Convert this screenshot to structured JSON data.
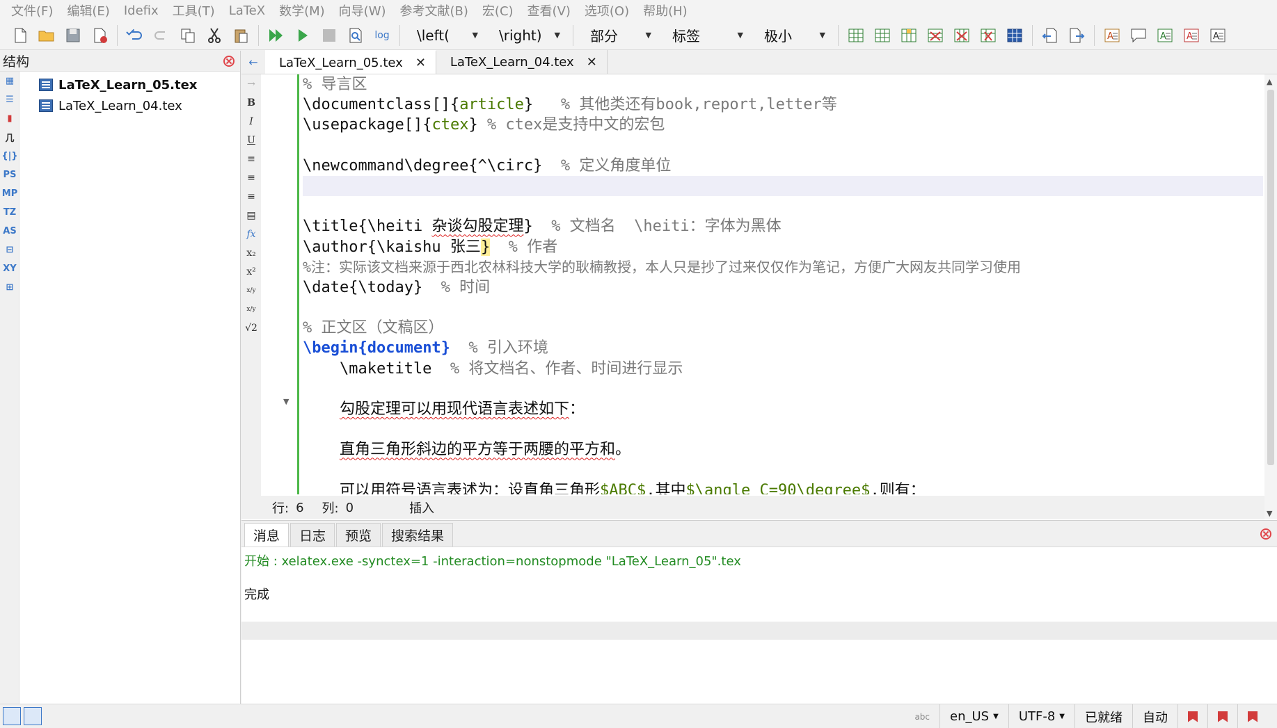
{
  "menu": [
    "文件(F)",
    "编辑(E)",
    "Idefix",
    "工具(T)",
    "LaTeX",
    "数学(M)",
    "向导(W)",
    "参考文献(B)",
    "宏(C)",
    "查看(V)",
    "选项(O)",
    "帮助(H)"
  ],
  "toolbar": {
    "log_label": "log",
    "combo_left": "\\left(",
    "combo_right": "\\right)",
    "combo_section": "部分",
    "combo_label": "标签",
    "combo_size": "极小"
  },
  "structure": {
    "title": "结构",
    "side_icons": [
      "",
      "",
      "",
      "",
      "{|}",
      "PS",
      "MP",
      "TZ",
      "AS",
      "",
      "XY",
      ""
    ],
    "files": [
      "LaTeX_Learn_05.tex",
      "LaTeX_Learn_04.tex"
    ]
  },
  "tabs": [
    "LaTeX_Learn_05.tex",
    "LaTeX_Learn_04.tex"
  ],
  "format_bar": [
    "B",
    "I",
    "U",
    "",
    "",
    "",
    "",
    "fx",
    "x₂",
    "x²",
    "x/y",
    "x/y",
    "√2"
  ],
  "code": {
    "l1": "% 导言区",
    "l2_cmd": "\\documentclass",
    "l2_br": "[]{",
    "l2_arg": "article",
    "l2_close": "}",
    "l2_cmt": "   % 其他类还有book,report,letter等",
    "l3_cmd": "\\usepackage",
    "l3_br": "[]{",
    "l3_arg": "ctex",
    "l3_close": "}",
    "l3_cmt": " % ctex是支持中文的宏包",
    "l5_cmd": "\\newcommand\\degree{^\\circ}",
    "l5_cmt": "  % 定义角度单位",
    "l8_cmd": "\\title{\\heiti ",
    "l8_sq": "杂谈勾股定理",
    "l8_close": "}",
    "l8_cmt": "  % 文档名  \\heiti：字体为黑体",
    "l9_cmd": "\\author{\\kaishu 张三",
    "l9_close": "}",
    "l9_cmt": "  % 作者",
    "l10": "%注：实际该文档来源于西北农林科技大学的耿楠教授，本人只是抄了过来仅仅作为笔记，方便广大网友共同学习使用",
    "l11_cmd": "\\date{\\today}",
    "l11_cmt": "  % 时间",
    "l13": "% 正文区（文稿区）",
    "l14_begin": "\\begin{",
    "l14_env": "document",
    "l14_close": "}",
    "l14_cmt": "  % 引入环境",
    "l15_cmd": "    \\maketitle",
    "l15_cmt": "  % 将文档名、作者、时间进行显示",
    "l17_sq": "勾股定理可以用现代语言表述如下",
    "l17_end": "：",
    "l19_sq": "直角三角形斜边的平方等于两腰的平方和",
    "l19_end": "。",
    "l21_sq1": "可以用符号语言表述为",
    "l21_mid": "：",
    "l21_sq2": "设直角三角形",
    "l21_m1": "$ABC$",
    "l21_t1": ",其中",
    "l21_m2": "$\\angle C=90\\degree$",
    "l21_t2": ",则有："
  },
  "cursor": {
    "row_label": "行:",
    "row": "6",
    "col_label": "列:",
    "col": "0",
    "mode": "插入"
  },
  "messages": {
    "tabs": [
      "消息",
      "日志",
      "预览",
      "搜索结果"
    ],
    "start_line": "开始 : xelatex.exe -synctex=1 -interaction=nonstopmode \"LaTeX_Learn_05\".tex",
    "done": "完成"
  },
  "statusbar": {
    "abc": "abc",
    "lang": "en_US",
    "encoding": "UTF-8",
    "ready": "已就绪",
    "auto": "自动"
  },
  "colors": {
    "accent": "#3c78c8",
    "change_bar": "#4db849",
    "comment": "#7a7a7a",
    "env": "#1a4fd6",
    "arg": "#4a7a00",
    "message_ok": "#228b22",
    "close": "#e0454a"
  }
}
